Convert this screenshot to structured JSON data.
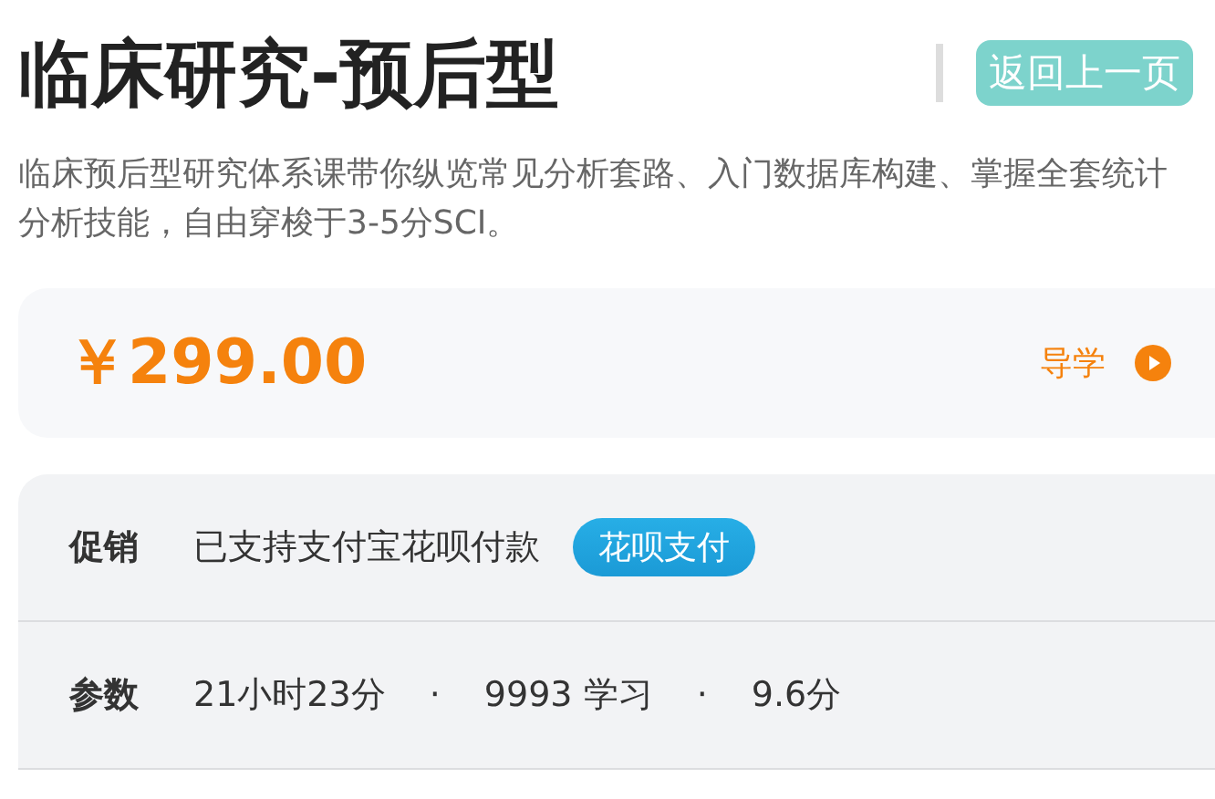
{
  "title": "临床研究-预后型",
  "back_button": "返回上一页",
  "description": "临床预后型研究体系课带你纵览常见分析套路、入门数据库构建、掌握全套统计分析技能，自由穿梭于3-5分SCI。",
  "price": "￥299.00",
  "guide_link": "导学",
  "promotion": {
    "label": "促销",
    "text": "已支持支付宝花呗付款",
    "tag": "花呗支付"
  },
  "params": {
    "label": "参数",
    "items": [
      "21小时23分",
      "·",
      "9993 学习",
      "·",
      "9.6分"
    ]
  }
}
